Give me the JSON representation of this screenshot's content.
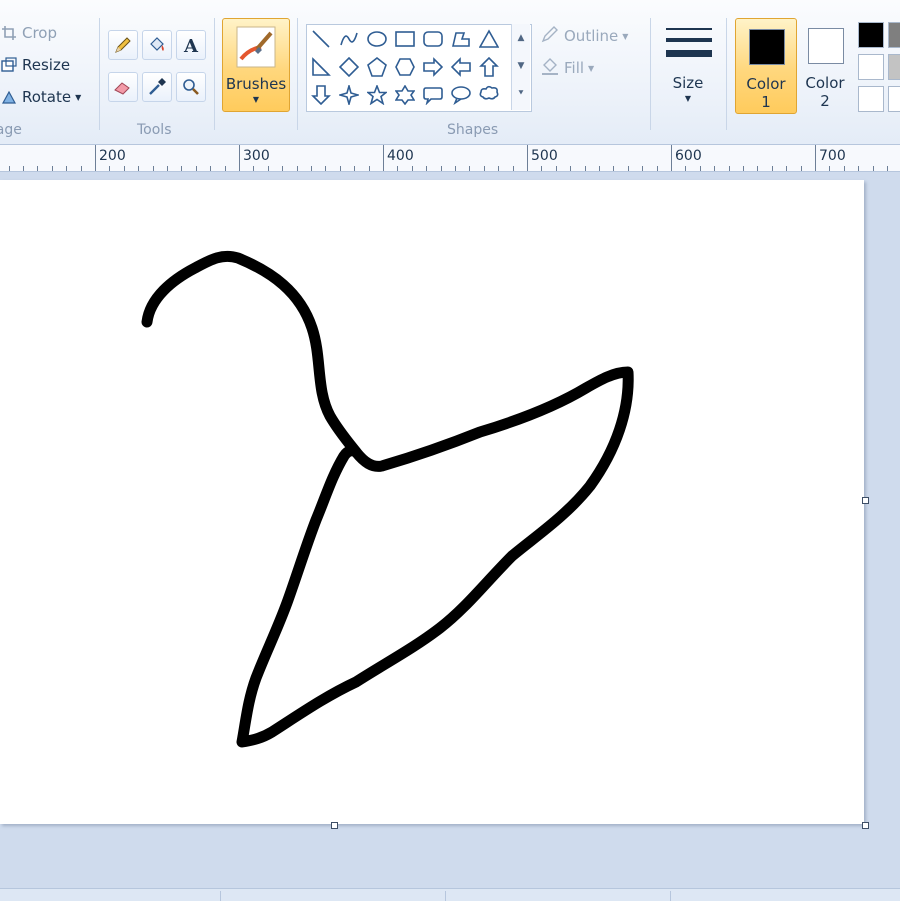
{
  "image_group": {
    "label": "Image",
    "crop_label": "Crop",
    "resize_label": "Resize",
    "rotate_label": "Rotate"
  },
  "tools_group": {
    "label": "Tools",
    "tools": [
      "pencil-icon",
      "fill-bucket-icon",
      "text-icon",
      "eraser-icon",
      "color-picker-icon",
      "magnifier-icon"
    ]
  },
  "brushes": {
    "label": "Brushes"
  },
  "shapes_group": {
    "label": "Shapes",
    "outline_label": "Outline",
    "fill_label": "Fill",
    "shapes": [
      "line",
      "curve",
      "oval",
      "rectangle",
      "rounded-rectangle",
      "polygon",
      "triangle",
      "right-triangle",
      "diamond",
      "pentagon",
      "hexagon",
      "right-arrow",
      "left-arrow",
      "up-arrow",
      "down-arrow",
      "four-point-star",
      "five-point-star",
      "six-point-star",
      "rounded-callout",
      "oval-callout",
      "cloud-callout"
    ]
  },
  "size": {
    "label": "Size"
  },
  "colors": {
    "color1_label": "Color\n1",
    "color2_label": "Color\n2",
    "color1": "#000000",
    "color2": "#ffffff",
    "palette_visible": [
      "#000000",
      "#7f7f7f",
      "#ffffff",
      "#c3c3c3",
      "#ffffff",
      "#ffffff"
    ]
  },
  "ruler": {
    "labels": [
      "200",
      "300",
      "400",
      "500",
      "600",
      "700"
    ]
  },
  "canvas": {
    "background": "#ffffff",
    "stroke_color": "#000000",
    "drawing_subject": "coat-hanger sketch"
  }
}
